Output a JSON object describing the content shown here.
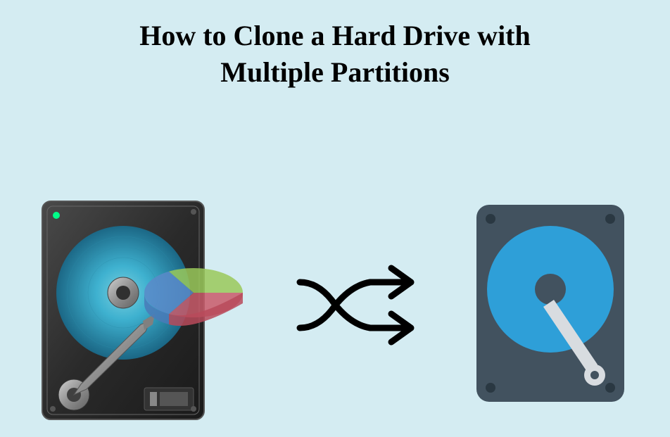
{
  "title_line1": "How to Clone a Hard Drive with",
  "title_line2": "Multiple Partitions"
}
